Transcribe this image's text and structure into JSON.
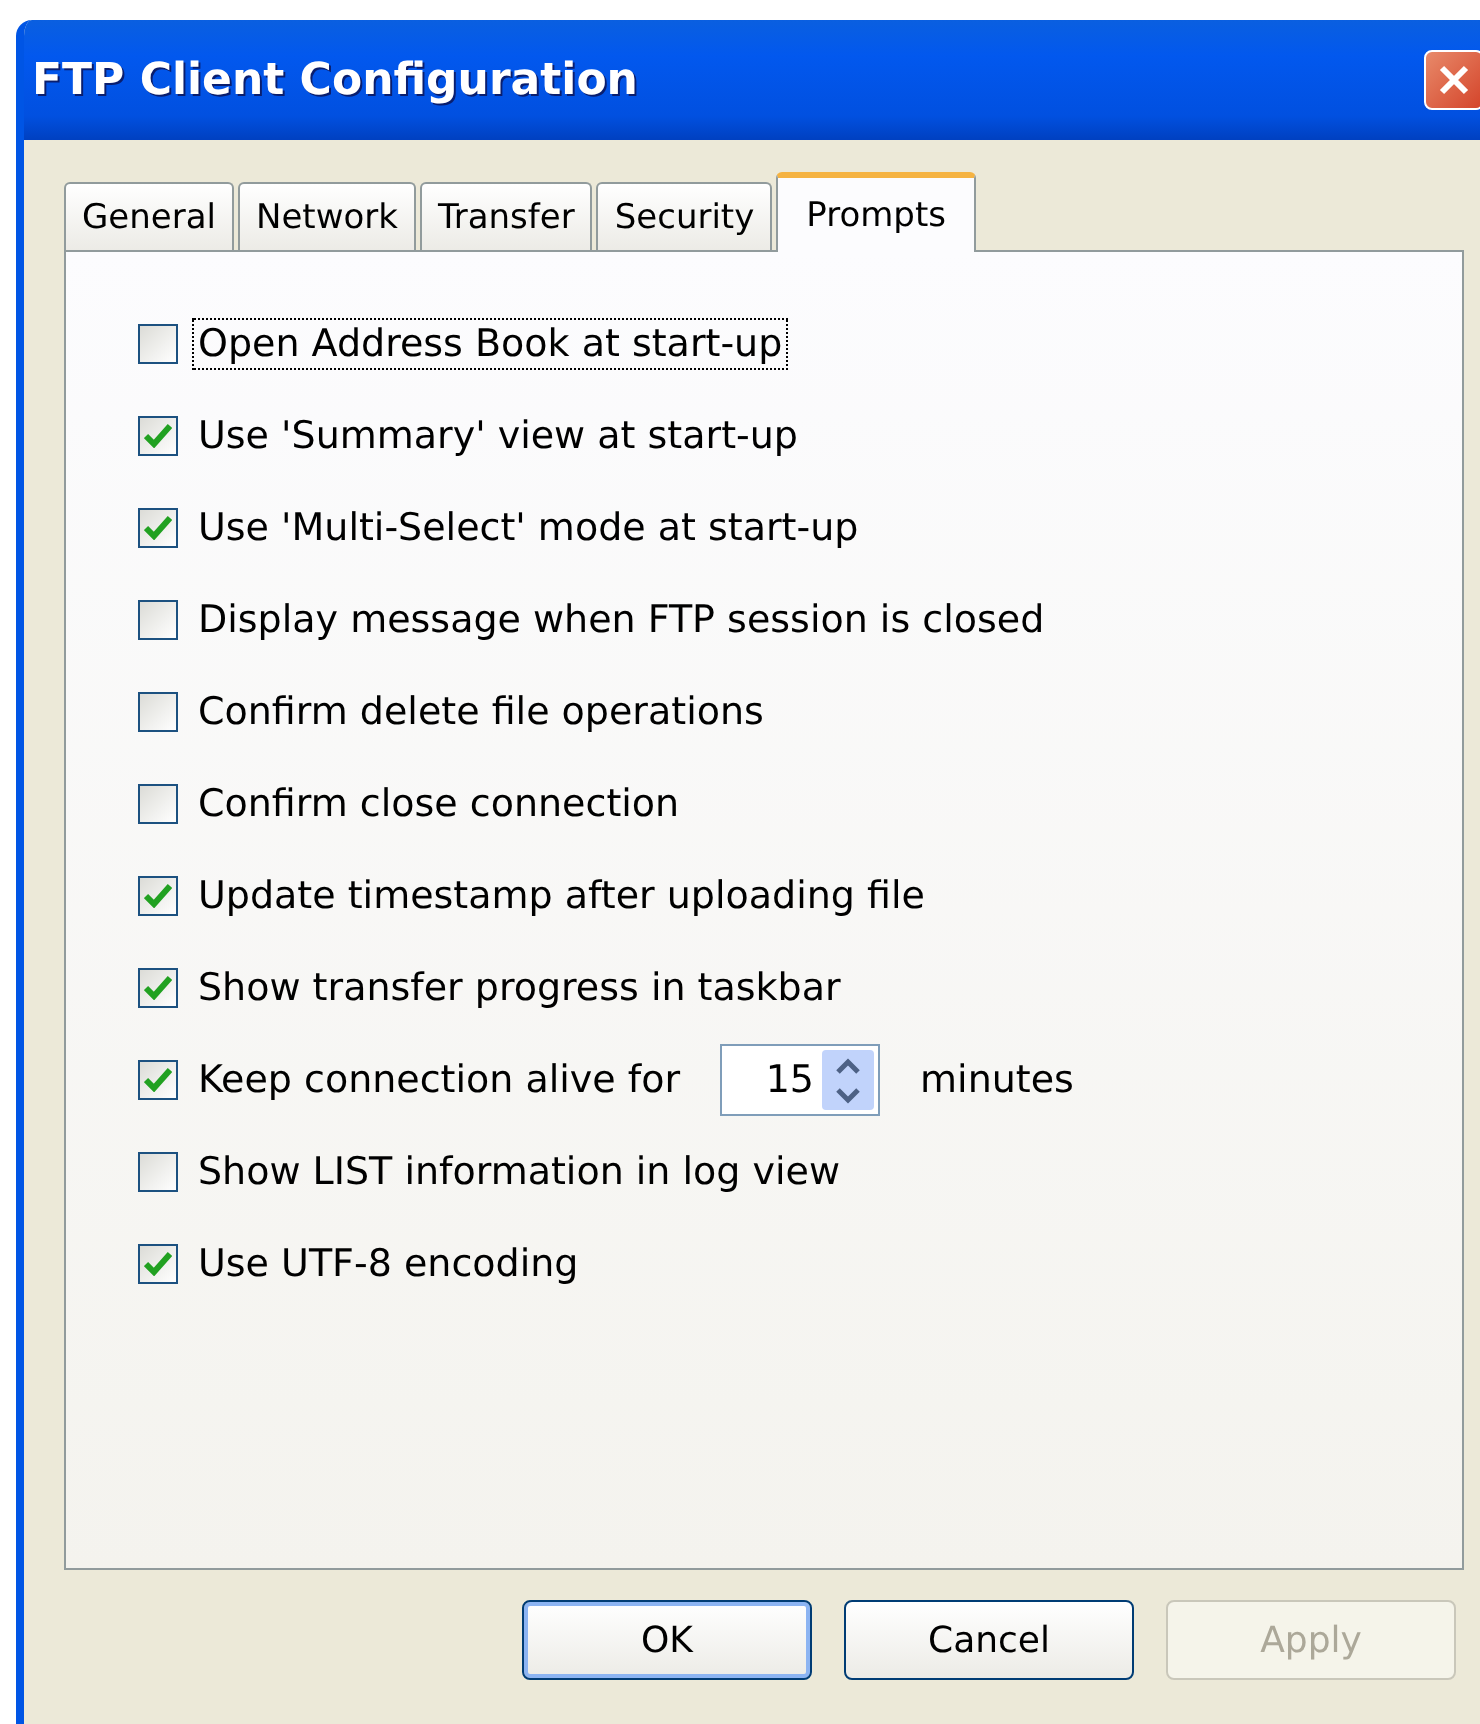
{
  "window": {
    "title": "FTP Client Configuration"
  },
  "tabs": [
    {
      "label": "General",
      "selected": false
    },
    {
      "label": "Network",
      "selected": false
    },
    {
      "label": "Transfer",
      "selected": false
    },
    {
      "label": "Security",
      "selected": false
    },
    {
      "label": "Prompts",
      "selected": true
    }
  ],
  "options": [
    {
      "kind": "checkbox",
      "label": "Open Address Book at start-up",
      "checked": false,
      "focused": true
    },
    {
      "kind": "checkbox",
      "label": "Use 'Summary' view at start-up",
      "checked": true,
      "focused": false
    },
    {
      "kind": "checkbox",
      "label": "Use 'Multi-Select' mode at start-up",
      "checked": true,
      "focused": false
    },
    {
      "kind": "checkbox",
      "label": "Display message when FTP session is closed",
      "checked": false,
      "focused": false
    },
    {
      "kind": "checkbox",
      "label": "Confirm delete file operations",
      "checked": false,
      "focused": false
    },
    {
      "kind": "checkbox",
      "label": "Confirm close connection",
      "checked": false,
      "focused": false
    },
    {
      "kind": "checkbox",
      "label": "Update timestamp after uploading file",
      "checked": true,
      "focused": false
    },
    {
      "kind": "checkbox",
      "label": "Show transfer progress in taskbar",
      "checked": true,
      "focused": false
    },
    {
      "kind": "spin",
      "label": "Keep connection alive for",
      "checked": true,
      "focused": false,
      "value": "15",
      "unit": "minutes"
    },
    {
      "kind": "checkbox",
      "label": "Show LIST information in log view",
      "checked": false,
      "focused": false
    },
    {
      "kind": "checkbox",
      "label": "Use UTF-8 encoding",
      "checked": true,
      "focused": false
    }
  ],
  "buttons": [
    {
      "label": "OK",
      "default": true,
      "disabled": false
    },
    {
      "label": "Cancel",
      "default": false,
      "disabled": false
    },
    {
      "label": "Apply",
      "default": false,
      "disabled": true
    }
  ]
}
